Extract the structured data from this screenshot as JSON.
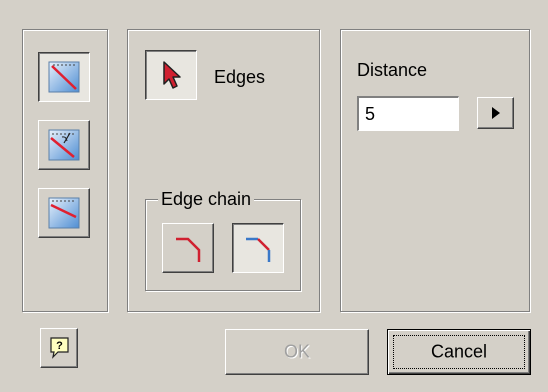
{
  "selection": {
    "edges_label": "Edges",
    "edge_chain_label": "Edge chain"
  },
  "distance": {
    "label": "Distance",
    "value": "5"
  },
  "buttons": {
    "ok_label": "OK",
    "cancel_label": "Cancel"
  },
  "icons": {
    "chamfer_distance": "chamfer-distance-icon",
    "chamfer_distance_angle": "chamfer-distance-angle-icon",
    "chamfer_two_distances": "chamfer-two-distances-icon",
    "select_edges": "arrow-pointer-icon",
    "chain_on": "edge-chain-on-icon",
    "chain_off": "edge-chain-off-icon",
    "help": "help-icon",
    "flyout": "triangle-right-icon"
  },
  "colors": {
    "background": "#d4d0c8",
    "accent_red": "#d02030",
    "accent_blue": "#3a78c8"
  }
}
